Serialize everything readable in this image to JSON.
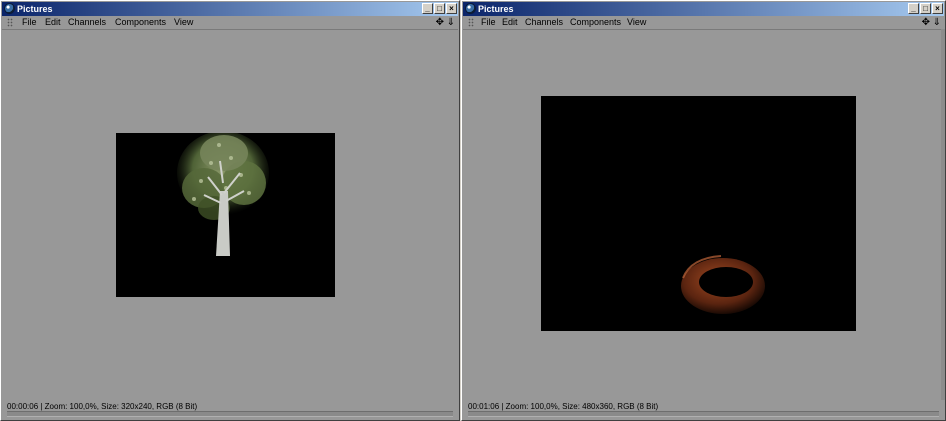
{
  "windows": [
    {
      "title": "Pictures",
      "menu": [
        "File",
        "Edit",
        "Channels",
        "Components",
        "View"
      ],
      "status": "00:00:06 | Zoom: 100,0%, Size: 320x240, RGB (8 Bit)",
      "image_content": "tree"
    },
    {
      "title": "Pictures",
      "menu": [
        "File",
        "Edit",
        "Channels",
        "Components",
        "View"
      ],
      "status": "00:01:06 | Zoom: 100,0%, Size: 480x360, RGB (8 Bit)",
      "image_content": "ring"
    }
  ],
  "icons": {
    "app": "app-icon",
    "minimize": "minimize-icon",
    "maximize": "maximize-icon",
    "close": "close-icon",
    "move": "move-icon",
    "down": "arrow-down-icon"
  },
  "colors": {
    "titlebar_start": "#0a246a",
    "titlebar_end": "#a6caf0",
    "window_bg": "#989898",
    "image_bg": "#000000",
    "ring": "#8a3e1c"
  }
}
